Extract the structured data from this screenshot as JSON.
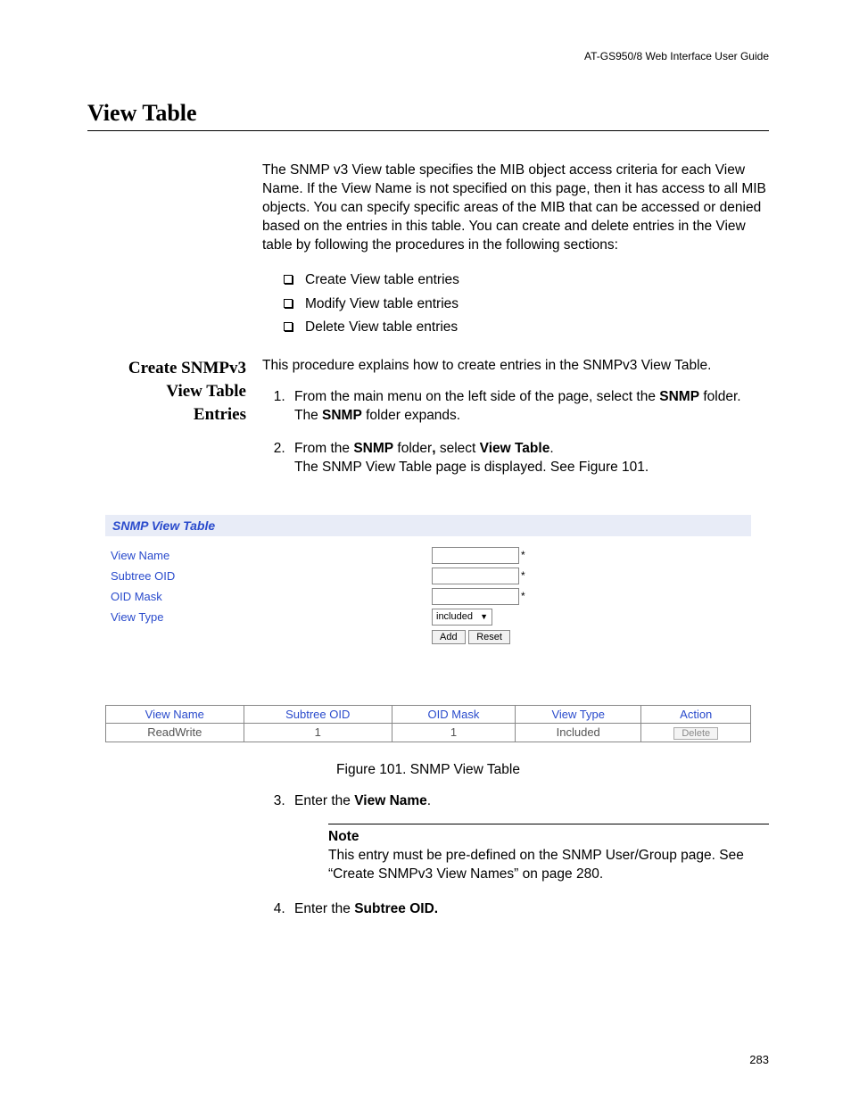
{
  "running_header": "AT-GS950/8  Web Interface User Guide",
  "section_title": "View Table",
  "intro": "The SNMP v3 View table specifies the MIB object access criteria for each View Name. If the View Name is not specified on this page, then it has access to all MIB objects. You can specify specific areas of the MIB that can be accessed or denied based on the entries in this table. You can create and delete entries in the View table by following the procedures in the following sections:",
  "bullets": [
    "Create View table entries",
    "Modify View table entries",
    "Delete View table entries"
  ],
  "side_heading": {
    "l1": "Create SNMPv3",
    "l2": "View Table",
    "l3": "Entries"
  },
  "side_intro": "This procedure explains how to create entries in the SNMPv3 View Table.",
  "steps": {
    "s1": {
      "a": "From the main menu on the left side of the page, select the ",
      "b": "SNMP",
      "c": " folder.",
      "d": "The ",
      "e": "SNMP",
      "f": " folder expands."
    },
    "s2": {
      "a": "From the ",
      "b": "SNMP",
      "c": " folder",
      "comma": ",",
      "d": " select ",
      "e": "View Table",
      "f": ".",
      "g": "The SNMP View Table page is displayed. See Figure 101."
    },
    "s3": {
      "a": "Enter the ",
      "b": "View Name",
      "c": "."
    },
    "s4": {
      "a": "Enter the ",
      "b": "Subtree OID.",
      "c": ""
    }
  },
  "panel_title": "SNMP View Table",
  "form": {
    "view_name": "View Name",
    "subtree_oid": "Subtree OID",
    "oid_mask": "OID Mask",
    "view_type": "View Type",
    "select_value": "included",
    "star": "*",
    "add": "Add",
    "reset": "Reset"
  },
  "table": {
    "headers": [
      "View Name",
      "Subtree OID",
      "OID Mask",
      "View Type",
      "Action"
    ],
    "row": [
      "ReadWrite",
      "1",
      "1",
      "Included"
    ],
    "delete": "Delete"
  },
  "caption": "Figure 101. SNMP View Table",
  "note": {
    "title": "Note",
    "body": "This entry must be pre-defined on the SNMP User/Group page. See “Create SNMPv3 View Names” on page 280."
  },
  "page_number": "283"
}
